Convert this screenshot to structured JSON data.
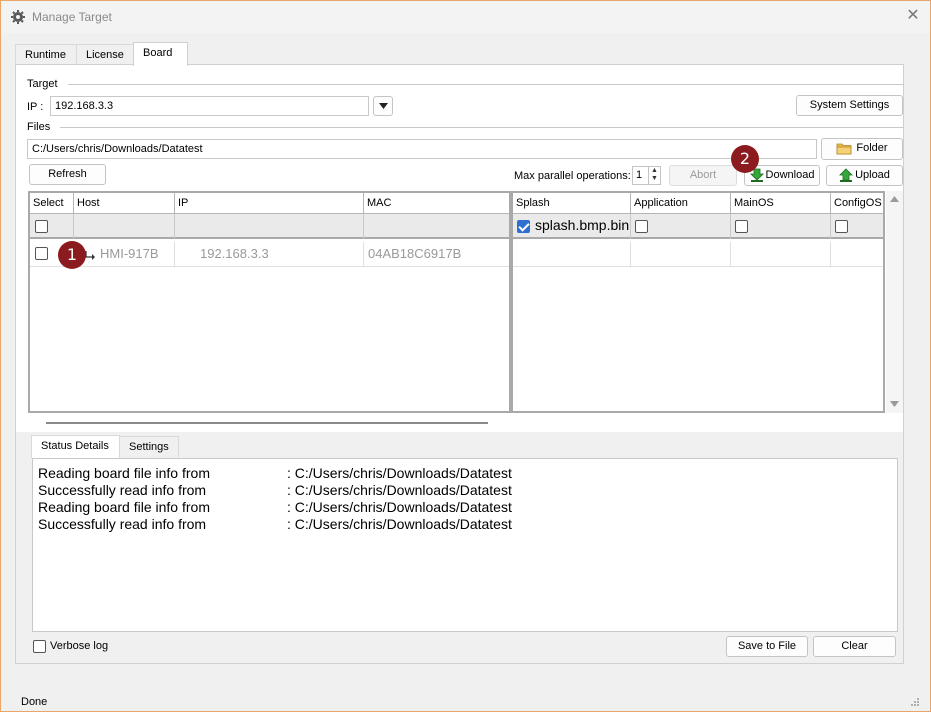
{
  "window": {
    "title": "Manage Target",
    "close_glyph": "✕"
  },
  "tabs": [
    {
      "label": "Runtime"
    },
    {
      "label": "License"
    },
    {
      "label": "Board"
    }
  ],
  "target": {
    "group_label": "Target",
    "ip_label": "IP :",
    "ip_value": "192.168.3.3",
    "system_settings_label": "System Settings"
  },
  "files": {
    "group_label": "Files",
    "path": "C:/Users/chris/Downloads/Datatest",
    "folder_label": "Folder"
  },
  "toolbar": {
    "refresh_label": "Refresh",
    "max_parallel_label": "Max parallel operations:",
    "max_parallel_value": "1",
    "abort_label": "Abort",
    "download_label": "Download",
    "upload_label": "Upload"
  },
  "left_grid": {
    "columns": [
      "Select",
      "Host",
      "IP",
      "MAC"
    ],
    "rows": [
      {
        "host": "HMI-917B",
        "ip": "192.168.3.3",
        "mac": "04AB18C6917B"
      }
    ]
  },
  "right_grid": {
    "columns": [
      "Splash",
      "Application",
      "MainOS",
      "ConfigOS"
    ],
    "splash_file": "splash.bmp.bin"
  },
  "badges": [
    "1",
    "2"
  ],
  "bottom_tabs": [
    {
      "label": "Status Details"
    },
    {
      "label": "Settings"
    }
  ],
  "log": [
    {
      "msg": "Reading board file info from",
      "value": ": C:/Users/chris/Downloads/Datatest"
    },
    {
      "msg": "Successfully read info from",
      "value": ": C:/Users/chris/Downloads/Datatest"
    },
    {
      "msg": "Reading board file info from",
      "value": ": C:/Users/chris/Downloads/Datatest"
    },
    {
      "msg": "Successfully read info from",
      "value": ": C:/Users/chris/Downloads/Datatest"
    }
  ],
  "footer": {
    "verbose_label": "Verbose log",
    "save_label": "Save to File",
    "clear_label": "Clear"
  },
  "status_bar": {
    "text": "Done"
  },
  "colors": {
    "badge": "#8b1b1f",
    "accent_check": "#2f6fd0",
    "window_border": "#e8a66b"
  }
}
